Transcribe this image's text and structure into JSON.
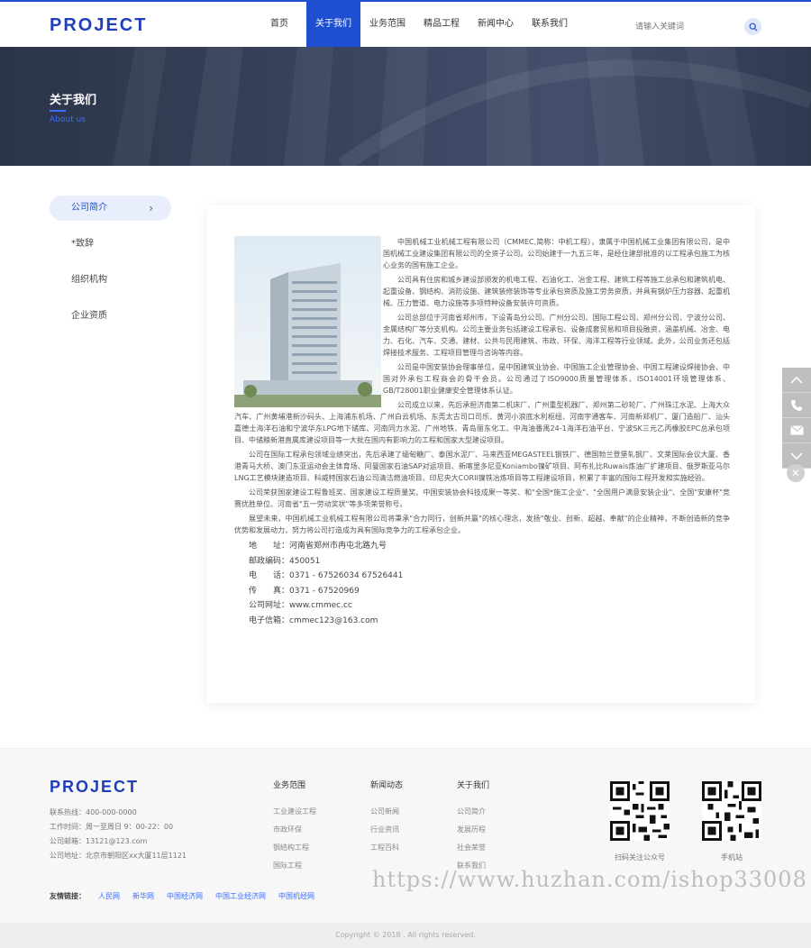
{
  "header": {
    "logo": "PROJECT",
    "nav": [
      "首页",
      "关于我们",
      "业务范围",
      "精品工程",
      "新闻中心",
      "联系我们"
    ],
    "search_placeholder": "请输入关键词"
  },
  "banner": {
    "title": "关于我们",
    "subtitle": "About us"
  },
  "sidebar": {
    "items": [
      "公司简介",
      "*致辞",
      "组织机构",
      "企业资质"
    ]
  },
  "article": {
    "paragraphs": [
      "中国机械工业机械工程有限公司（CMMEC,简称：中机工程），隶属于中国机械工业集团有限公司，是中国机械工业建设集团有限公司的全资子公司。公司始建于一九五三年，是经住建部批准的以工程承包施工为核心业务的国有施工企业。",
      "公司具有住房和城乡建设部颁发的机电工程、石油化工、冶金工程、建筑工程等施工总承包和建筑机电、起重设备、钢结构、消防设施、建筑装修装饰等专业承包资质及施工劳务资质，并具有锅炉压力容器、起重机械、压力管道、电力设施等多项特种设备安装许可资质。",
      "公司总部位于河南省郑州市，下设青岛分公司、广州分公司、国际工程公司、郑州分公司、宁波分公司、金属结构厂等分支机构。公司主要业务包括建设工程承包、设备成套贸易和项目投融资，涵盖机械、冶金、电力、石化、汽车、交通、建材、公共与民用建筑、市政、环保、海洋工程等行业领域。此外，公司业务还包括焊接技术服务、工程项目管理与咨询等内容。",
      "公司是中国安装协会理事单位，是中国建筑业协会、中国施工企业管理协会、中国工程建设焊接协会、中国对外承包工程商会的骨干会员。公司通过了ISO9000质量管理体系、ISO14001环境管理体系、GB/T28001职业健康安全管理体系认证。",
      "公司成立以来，先后承担济南第二机床厂、广州重型机器厂、郑州第二砂轮厂、广州珠江水泥、上海大众汽车、广州黄埔港新沙码头、上海浦东机场、广州白云机场、东莞太古司口司乐、黄河小浪底水利枢纽、河南宇通客车、河南新郑机厂、厦门造船厂、汕头嘉德士海洋石油和宁波华东LPG地下储库、河南同力水泥、广州地铁、青岛丽东化工、中海油番禺24-1海洋石油平台、宁波SK三元乙丙橡胶EPC总承包项目、中储粮新港直属库建设项目等一大批在国内有影响力的工程和国家大型建设项目。",
      "公司在国际工程承包领域业绩突出，先后承建了缅甸糖厂、泰国水泥厂、马来西亚MEGASTEEL钢铁厂、德国勃兰登堡轧钢厂、文莱国际会议大厦、香港青马大桥、澳门东亚运动会主体育场、阿曼国家石油SAP对运项目、新喀里多尼亚Koniambo镍矿项目、阿布扎比Ruwais炼油厂扩建项目、俄罗斯亚马尔LNG工艺模块建造项目、科威特国家石油公司清洁燃油项目、印尼央大CORII镍铁冶炼项目等工程建设项目，积累了丰富的国际工程开发和实施经验。",
      "公司荣获国家建设工程鲁班奖、国家建设工程质量奖、中国安装协会科技成果一等奖、和\"全国*施工企业\"、\"全国用户满意安装企业\"、全国\"安康杯\"竞赛优胜单位、河南省\"五一劳动奖状\"等多项荣誉称号。",
      "展望未来，中国机械工业机械工程有限公司将秉承\"合力同行，创新共赢\"的核心理念，发扬\"敬业、创新、超越、奉献\"的企业精神，不断创造新的竞争优势和发展动力，努力将公司打造成为具有国际竞争力的工程承包企业。"
    ],
    "contact": [
      "地　　址：河南省郑州市冉屯北路九号",
      "邮政编码：450051",
      "电　　话：0371 - 67526034 67526441",
      "传　　真：0371 - 67520969",
      "公司网址：www.cmmec.cc",
      "电子信箱：cmmec123@163.com"
    ]
  },
  "footer": {
    "logo": "PROJECT",
    "info": [
      "联系热线：400-000-0000",
      "工作时间：周一至周日 9：00-22：00",
      "公司邮箱：13121@123.com",
      "公司地址：北京市朝阳区xx大厦11层1121"
    ],
    "col1": {
      "title": "业务范围",
      "links": [
        "工业建设工程",
        "市政环保",
        "钢结构工程",
        "国际工程"
      ]
    },
    "col2": {
      "title": "新闻动态",
      "links": [
        "公司新闻",
        "行业资讯",
        "工程百科"
      ]
    },
    "col3": {
      "title": "关于我们",
      "links": [
        "公司简介",
        "发展历程",
        "社会荣誉",
        "联系我们"
      ]
    },
    "qr1_label": "扫码关注公众号",
    "qr2_label": "手机站",
    "links_label": "友情链接：",
    "friend_links": [
      "人民网",
      "新华网",
      "中国经济网",
      "中国工业经济网",
      "中国机经网"
    ],
    "watermark": "https://www.huzhan.com/ishop33008",
    "copyright": "Copyright © 2018 . All rights reserved."
  }
}
